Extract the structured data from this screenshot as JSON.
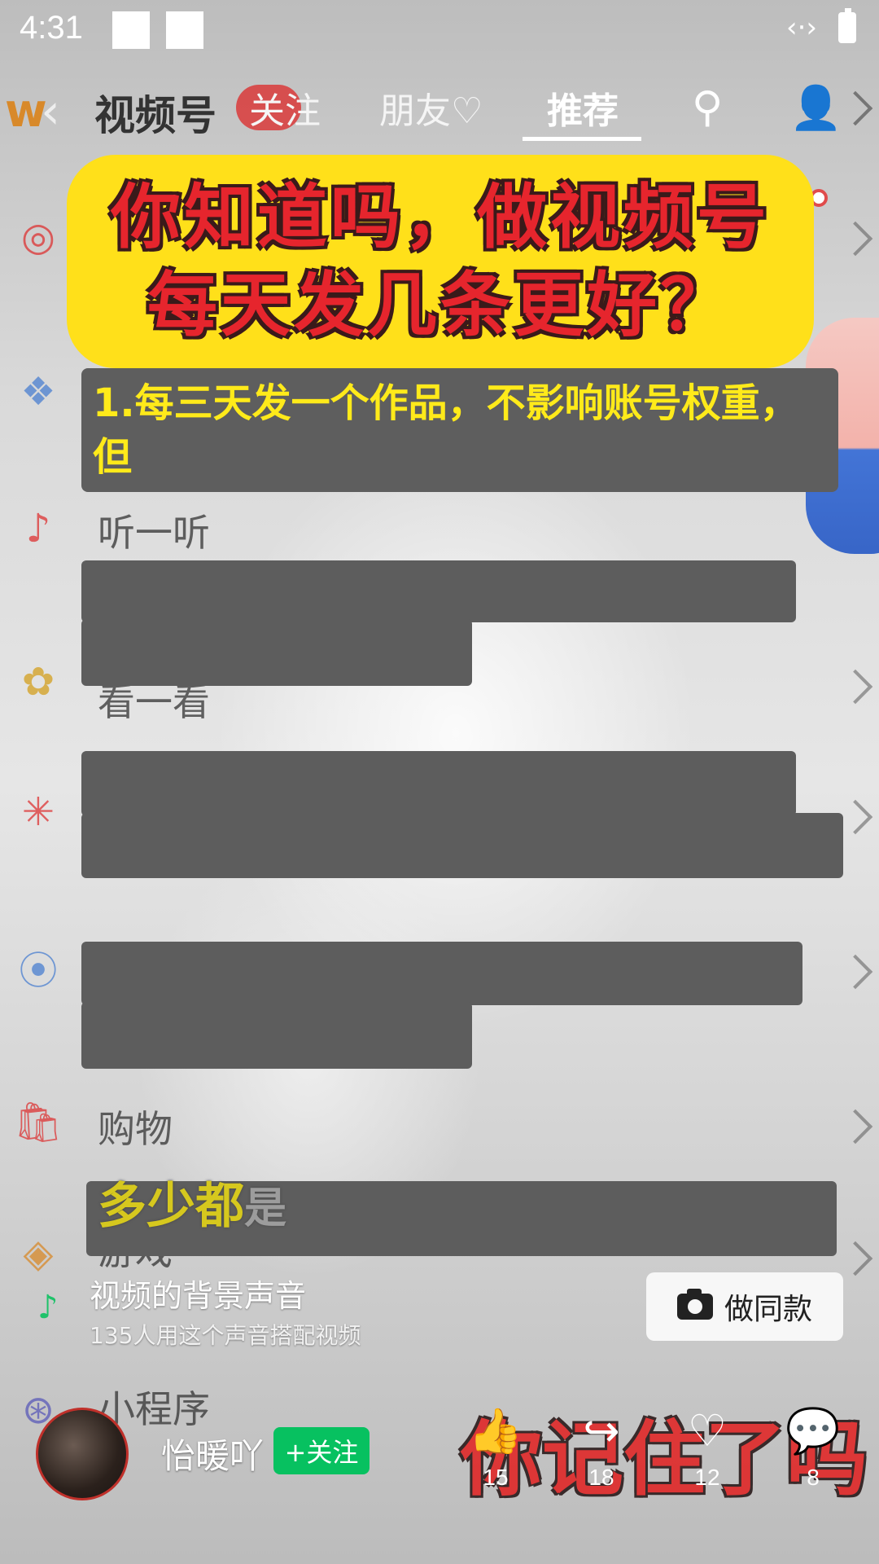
{
  "status_bar": {
    "time": "4:31"
  },
  "drawer_behind": {
    "items": [
      {
        "label": "听一听",
        "icon": "music-note-icon"
      },
      {
        "label": "看一看",
        "icon": "flower-icon"
      },
      {
        "label": "购物",
        "icon": "shopping-bag-icon"
      },
      {
        "label": "游戏",
        "icon": "game-icon"
      },
      {
        "label": "小程序",
        "icon": "mini-program-icon"
      }
    ]
  },
  "top_nav": {
    "brand": "视频号",
    "tabs": [
      {
        "label": "关注"
      },
      {
        "label": "朋友♡"
      },
      {
        "label": "推荐",
        "active": true
      }
    ]
  },
  "video": {
    "title_line1": "你知道吗，做视频号",
    "title_line2": "每天发几条更好？",
    "caption": "1.每三天发一个作品，不影响账号权重，但",
    "subtitle_left": "多少都",
    "subtitle_faint": "是",
    "big_subtitle": "你记住了吗"
  },
  "music": {
    "title": "视频的背景声音",
    "usage": "135人用这个声音搭配视频"
  },
  "make_same_button": {
    "label": "做同款"
  },
  "author": {
    "name": "怡暖吖",
    "follow_label": "+关注"
  },
  "actions": {
    "like_count": "15",
    "share_count": "18",
    "favorite_count": "12",
    "comment_count": "8"
  },
  "colors": {
    "accent_green": "#07c160",
    "banner_yellow": "#ffe01a",
    "banner_red": "#e6252d"
  }
}
